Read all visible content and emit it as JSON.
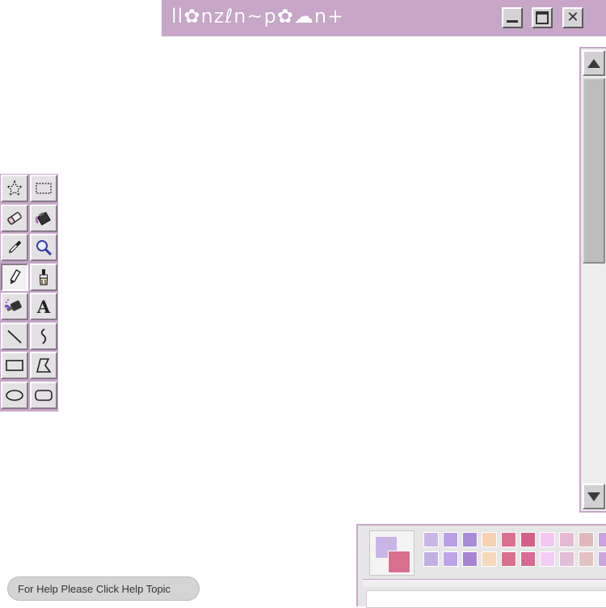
{
  "window": {
    "title": "ll✿nzℓn~p✿☁n+",
    "buttons": {
      "minimize": "minimize-icon",
      "maximize": "maximize-icon",
      "close": "✕"
    }
  },
  "colors": {
    "accent": "#c7a6c9",
    "foreground": "#c9b6e6",
    "background": "#d9708f"
  },
  "tools": [
    {
      "name": "free-select",
      "icon": "star-select-icon",
      "row": 0,
      "col": 0
    },
    {
      "name": "rect-select",
      "icon": "rect-select-icon",
      "row": 0,
      "col": 1
    },
    {
      "name": "eraser",
      "icon": "eraser-icon",
      "row": 1,
      "col": 0
    },
    {
      "name": "fill",
      "icon": "paint-bucket-icon",
      "row": 1,
      "col": 1
    },
    {
      "name": "color-picker",
      "icon": "eyedropper-icon",
      "row": 2,
      "col": 0
    },
    {
      "name": "magnifier",
      "icon": "magnifier-icon",
      "row": 2,
      "col": 1
    },
    {
      "name": "pencil",
      "icon": "pencil-icon",
      "row": 3,
      "col": 0,
      "pressed": true
    },
    {
      "name": "brush",
      "icon": "brush-icon",
      "row": 3,
      "col": 1
    },
    {
      "name": "airbrush",
      "icon": "airbrush-icon",
      "row": 4,
      "col": 0
    },
    {
      "name": "text",
      "icon": "text-icon",
      "row": 4,
      "col": 1,
      "glyph": "A"
    },
    {
      "name": "line",
      "icon": "line-icon",
      "row": 5,
      "col": 0
    },
    {
      "name": "curve",
      "icon": "curve-icon",
      "row": 5,
      "col": 1
    },
    {
      "name": "rectangle",
      "icon": "rectangle-icon",
      "row": 6,
      "col": 0
    },
    {
      "name": "polygon",
      "icon": "polygon-icon",
      "row": 6,
      "col": 1
    },
    {
      "name": "ellipse",
      "icon": "ellipse-icon",
      "row": 7,
      "col": 0
    },
    {
      "name": "rounded-rectangle",
      "icon": "rounded-rect-icon",
      "row": 7,
      "col": 1
    }
  ],
  "palette": {
    "row1": [
      "#c9b6e6",
      "#b9a0e6",
      "#a88bd8",
      "#f5d2b0",
      "#d9708f",
      "#d45f88",
      "#f3c8f5",
      "#e4b9d6",
      "#e0b8bb",
      "#caa3e0"
    ],
    "row2": [
      "#c2b0e4",
      "#bfa4ea",
      "#a883d3",
      "#f7d8b8",
      "#d9708f",
      "#d66a92",
      "#f4cdf6",
      "#e2bed8",
      "#e2c1c2",
      "#c8a6df"
    ]
  },
  "status": {
    "help_text": "For Help Please Click Help Topic"
  }
}
